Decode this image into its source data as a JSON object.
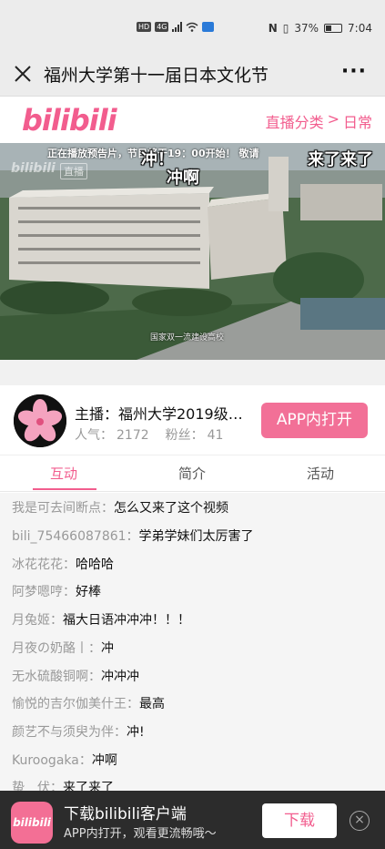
{
  "status_bar": {
    "badges": [
      "HD",
      "4G"
    ],
    "battery": "37%",
    "time": "7:04"
  },
  "title_bar": {
    "title": "福州大学第十一届日本文化节",
    "more_label": "···"
  },
  "bili_header": {
    "logo_text": "bilibili",
    "breadcrumb": {
      "category": "直播分类",
      "separator": ">",
      "subcategory": "日常"
    }
  },
  "video": {
    "notice": "正在播放预告片，节目将于19：00开始！ 敬请",
    "danmaku": [
      "冲！",
      "来了来了",
      "冲啊"
    ],
    "watermark": "bilibili",
    "watermark_badge": "直播",
    "caption": "国家双一流建设高校"
  },
  "host": {
    "name": "主播：福州大学2019级…",
    "popularity_label": "人气：",
    "popularity": "2172",
    "fans_label": "粉丝：",
    "fans": "41",
    "open_in_app": "APP内打开"
  },
  "tabs": [
    {
      "label": "互动",
      "active": true
    },
    {
      "label": "简介",
      "active": false
    },
    {
      "label": "活动",
      "active": false
    }
  ],
  "chat": [
    {
      "user": "我是可去间断点：",
      "message": "怎么又来了这个视频"
    },
    {
      "user": "bili_75466087861：",
      "message": "学弟学妹们太厉害了"
    },
    {
      "user": "冰花花花：",
      "message": "哈哈哈"
    },
    {
      "user": "阿梦嗯哼：",
      "message": "好棒"
    },
    {
      "user": "月兔姬：",
      "message": "福大日语冲冲冲！！！"
    },
    {
      "user": "月夜の奶酪丨：",
      "message": "冲"
    },
    {
      "user": "无水硫酸铜啊：",
      "message": "冲冲冲"
    },
    {
      "user": "愉悦的吉尔伽美什王：",
      "message": "最高"
    },
    {
      "user": "颜艺不与须臾为伴：",
      "message": "冲!"
    },
    {
      "user": "Kuroogaka：",
      "message": "冲啊"
    },
    {
      "user": "蛰　伏：",
      "message": "来了来了"
    }
  ],
  "banner": {
    "icon_text": "bilibili",
    "title": "下载bilibili客户端",
    "subtitle": "APP内打开，观看更流畅哦～",
    "download_label": "下载",
    "close_label": "×"
  },
  "colors": {
    "brand_pink": "#f25d8e",
    "button_pink": "#f27097",
    "banner_bg": "#2c2c2c"
  }
}
